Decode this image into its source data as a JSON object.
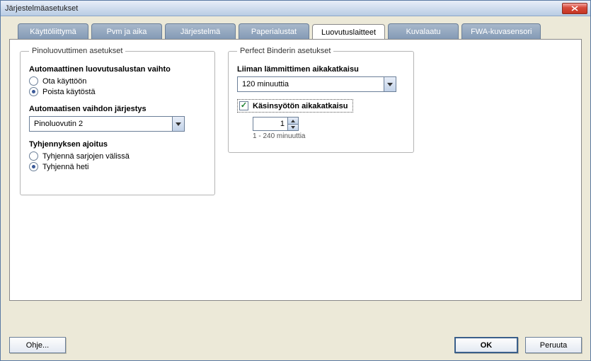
{
  "window": {
    "title": "Järjestelmäasetukset"
  },
  "tabs": [
    {
      "label": "Käyttöliittymä"
    },
    {
      "label": "Pvm ja aika"
    },
    {
      "label": "Järjestelmä"
    },
    {
      "label": "Paperialustat"
    },
    {
      "label": "Luovutuslaitteet"
    },
    {
      "label": "Kuvalaatu"
    },
    {
      "label": "FWA-kuvasensori"
    }
  ],
  "activeTab": 4,
  "stacker": {
    "legend": "Pinoluovuttimen asetukset",
    "autoSwitch": {
      "label": "Automaattinen luovutusalustan vaihto",
      "options": {
        "enable": "Ota käyttöön",
        "disable": "Poista käytöstä"
      },
      "selected": "disable"
    },
    "order": {
      "label": "Automaatisen vaihdon järjestys",
      "value": "Pinoluovutin 2"
    },
    "unload": {
      "label": "Tyhjennyksen ajoitus",
      "options": {
        "betweenSets": "Tyhjennä sarjojen välissä",
        "immediately": "Tyhjennä heti"
      },
      "selected": "immediately"
    }
  },
  "binder": {
    "legend": "Perfect Binderin asetukset",
    "glueTimeout": {
      "label": "Liiman lämmittimen aikakatkaisu",
      "value": "120 minuuttia"
    },
    "manualFeed": {
      "label": "Käsinsyötön aikakatkaisu",
      "checked": true,
      "value": "1",
      "hint": "1 - 240 minuuttia"
    }
  },
  "buttons": {
    "help": "Ohje...",
    "ok": "OK",
    "cancel": "Peruuta"
  }
}
